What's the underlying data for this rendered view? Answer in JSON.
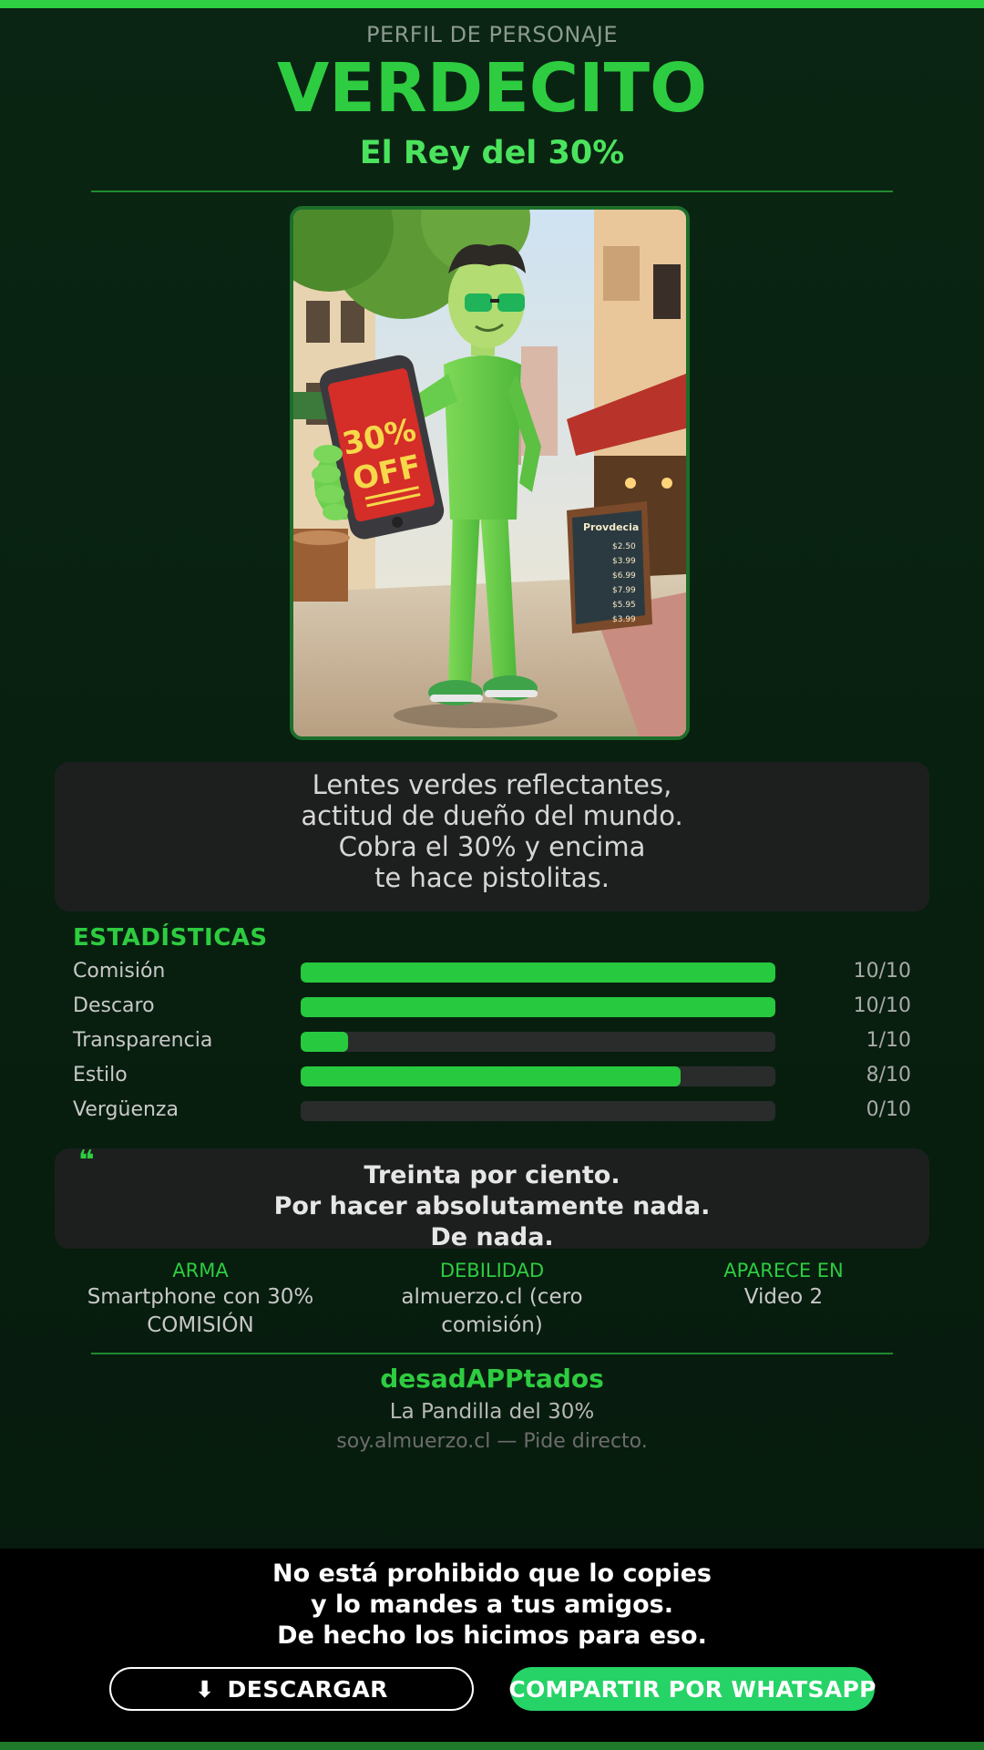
{
  "header": {
    "kicker": "PERFIL DE PERSONAJE",
    "name": "VERDECITO",
    "subtitle": "El Rey del 30%"
  },
  "portrait": {
    "phone_text_line1": "30%",
    "phone_text_line2": "OFF",
    "menu_board_title": "Provdecia",
    "menu_prices": [
      "$2.50",
      "$3.99",
      "$6.99",
      "$7.99",
      "$5.95",
      "$3.99"
    ]
  },
  "description": {
    "lines": [
      "Lentes verdes reflectantes,",
      "actitud de dueño del mundo.",
      "Cobra el 30% y encima",
      "te hace pistolitas."
    ]
  },
  "stats": {
    "title": "ESTADÍSTICAS",
    "items": [
      {
        "label": "Comisión",
        "value": "10/10",
        "level": 1.0
      },
      {
        "label": "Descaro",
        "value": "10/10",
        "level": 1.0
      },
      {
        "label": "Transparencia",
        "value": "1/10",
        "level": 0.1
      },
      {
        "label": "Estilo",
        "value": "8/10",
        "level": 0.8
      },
      {
        "label": "Vergüenza",
        "value": "0/10",
        "level": 0.0
      }
    ]
  },
  "quote": {
    "mark": "❝",
    "lines": [
      "Treinta por ciento.",
      "Por hacer absolutamente nada.",
      "De nada."
    ]
  },
  "info": {
    "weapon": {
      "label": "ARMA",
      "lines": [
        "Smartphone con 30%",
        "COMISIÓN"
      ]
    },
    "weakness": {
      "label": "DEBILIDAD",
      "lines": [
        "almuerzo.cl (cero",
        "comisión)"
      ]
    },
    "appears": {
      "label": "APARECE EN",
      "lines": [
        "Video 2"
      ]
    }
  },
  "footer": {
    "brand": "desadAPPtados",
    "tagline": "La Pandilla del 30%",
    "site": "soy.almuerzo.cl — Pide directo."
  },
  "share": {
    "lines": [
      "No está prohibido que lo copies",
      "y lo mandes a tus amigos.",
      "De hecho los hicimos para eso."
    ],
    "download_icon": "⬇",
    "download_label": "DESCARGAR",
    "whatsapp_label": "COMPARTIR POR WHATSAPP"
  },
  "colors": {
    "accent": "#2ecc40",
    "bar_fill": "#27c93f",
    "whatsapp": "#25d366",
    "background": "#0a2513"
  }
}
